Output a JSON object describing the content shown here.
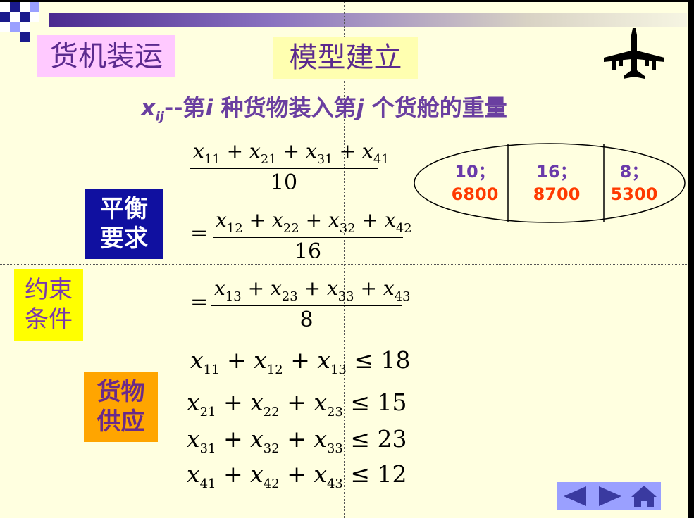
{
  "titles": {
    "cargo": "货机装运",
    "model": "模型建立"
  },
  "subtitle": {
    "var_x": "x",
    "var_sub": "ij",
    "dash": "--",
    "p1": "第",
    "i": "i",
    "p2": " 种货物装入第",
    "j": "j",
    "p3": " 个货舱的重量"
  },
  "labels": {
    "balance_1": "平衡",
    "balance_2": "要求",
    "constraint_1": "约束",
    "constraint_2": "条件",
    "supply_1": "货物",
    "supply_2": "供应"
  },
  "balance": {
    "num1": [
      "11",
      "21",
      "31",
      "41"
    ],
    "den1": "10",
    "num2": [
      "12",
      "22",
      "32",
      "42"
    ],
    "den2": "16",
    "num3": [
      "13",
      "23",
      "33",
      "43"
    ],
    "den3": "8",
    "equals": "="
  },
  "supply": [
    {
      "subs": [
        "11",
        "12",
        "13"
      ],
      "bound": "18"
    },
    {
      "subs": [
        "21",
        "22",
        "23"
      ],
      "bound": "15"
    },
    {
      "subs": [
        "31",
        "32",
        "33"
      ],
      "bound": "23"
    },
    {
      "subs": [
        "41",
        "42",
        "43"
      ],
      "bound": "12"
    }
  ],
  "compartments": [
    {
      "weight": "10；",
      "volume": "6800"
    },
    {
      "weight": "16；",
      "volume": "8700"
    },
    {
      "weight": "8；",
      "volume": "5300"
    }
  ],
  "icons": {
    "plane": "airplane-icon",
    "prev": "left-arrow-icon",
    "next": "right-arrow-icon",
    "home": "home-icon"
  },
  "colors": {
    "background": "#ffffe0",
    "title_text": "#5b2a8e",
    "balance_bg": "#1010a0",
    "constraint_bg": "#ffff00",
    "supply_bg": "#ffa500",
    "volume_text": "#ff3a00"
  }
}
